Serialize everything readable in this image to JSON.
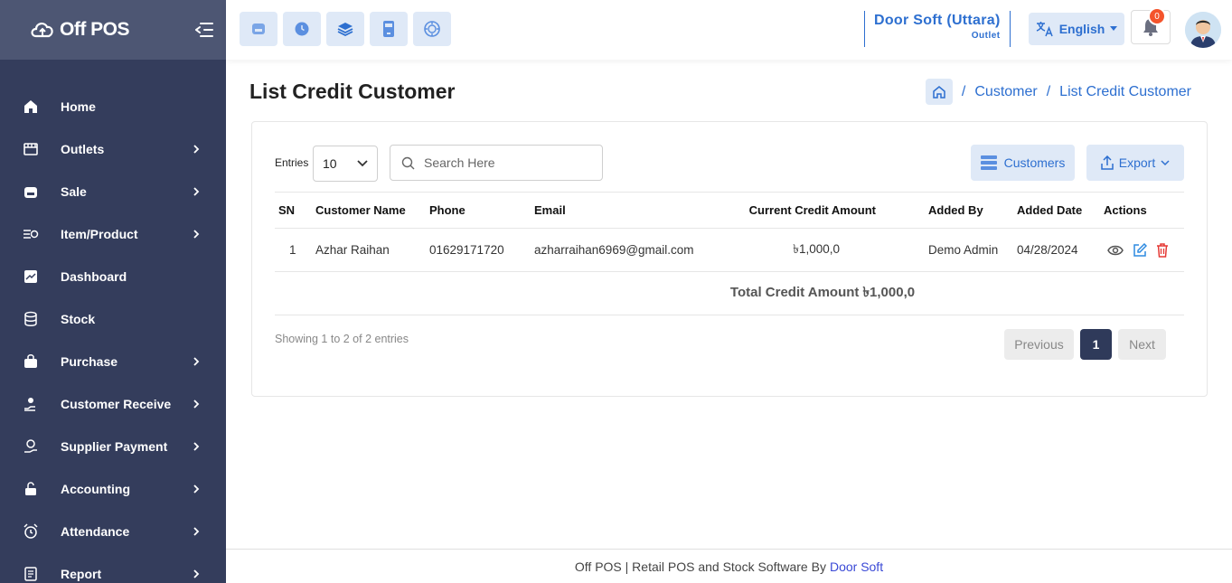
{
  "app": {
    "brand": "Off POS"
  },
  "sidebar": {
    "items": [
      {
        "label": "Home",
        "icon": "home-icon",
        "has_children": false
      },
      {
        "label": "Outlets",
        "icon": "store-icon",
        "has_children": true
      },
      {
        "label": "Sale",
        "icon": "basket-icon",
        "has_children": true
      },
      {
        "label": "Item/Product",
        "icon": "product-list-icon",
        "has_children": true
      },
      {
        "label": "Dashboard",
        "icon": "chart-icon",
        "has_children": false
      },
      {
        "label": "Stock",
        "icon": "database-icon",
        "has_children": false
      },
      {
        "label": "Purchase",
        "icon": "bag-icon",
        "has_children": true
      },
      {
        "label": "Customer Receive",
        "icon": "hand-coin-icon",
        "has_children": true
      },
      {
        "label": "Supplier Payment",
        "icon": "money-hand-icon",
        "has_children": true
      },
      {
        "label": "Accounting",
        "icon": "lock-open-icon",
        "has_children": true
      },
      {
        "label": "Attendance",
        "icon": "alarm-clock-icon",
        "has_children": true
      },
      {
        "label": "Report",
        "icon": "report-icon",
        "has_children": true
      }
    ]
  },
  "header": {
    "quick_icons": [
      "pos-icon",
      "clock-icon",
      "layers-icon",
      "calculator-icon",
      "dashboard-dial-icon"
    ],
    "outlet_name": "Door Soft (Uttara)",
    "outlet_sub": "Outlet",
    "language": "English",
    "notification_count": "0"
  },
  "page": {
    "title": "List Credit Customer",
    "breadcrumb": [
      "Customer",
      "List Credit Customer"
    ]
  },
  "controls": {
    "entries_label": "Entries",
    "entries_value": "10",
    "search_placeholder": "Search Here",
    "customers_button": "Customers",
    "export_button": "Export"
  },
  "table": {
    "headers": [
      "SN",
      "Customer Name",
      "Phone",
      "Email",
      "Current Credit Amount",
      "Added By",
      "Added Date",
      "Actions"
    ],
    "rows": [
      {
        "sn": "1",
        "name": "Azhar Raihan",
        "phone": "01629171720",
        "email": "azharraihan6969@gmail.com",
        "amount": "৳1,000,0",
        "added_by": "Demo Admin",
        "added_date": "04/28/2024"
      }
    ],
    "total_label": "Total Credit Amount ৳1,000,0"
  },
  "pagination": {
    "showing": "Showing 1 to 2 of 2 entries",
    "previous": "Previous",
    "current": "1",
    "next": "Next"
  },
  "footer": {
    "text": "Off POS | Retail POS and Stock Software By",
    "link": "Door Soft"
  },
  "colors": {
    "sidebar_bg": "#343d5c",
    "brand_bg": "#4d5673",
    "accent": "#2d6fd0",
    "accent_light": "#dfe9f7",
    "badge": "#f4542c",
    "danger": "#e53935"
  }
}
